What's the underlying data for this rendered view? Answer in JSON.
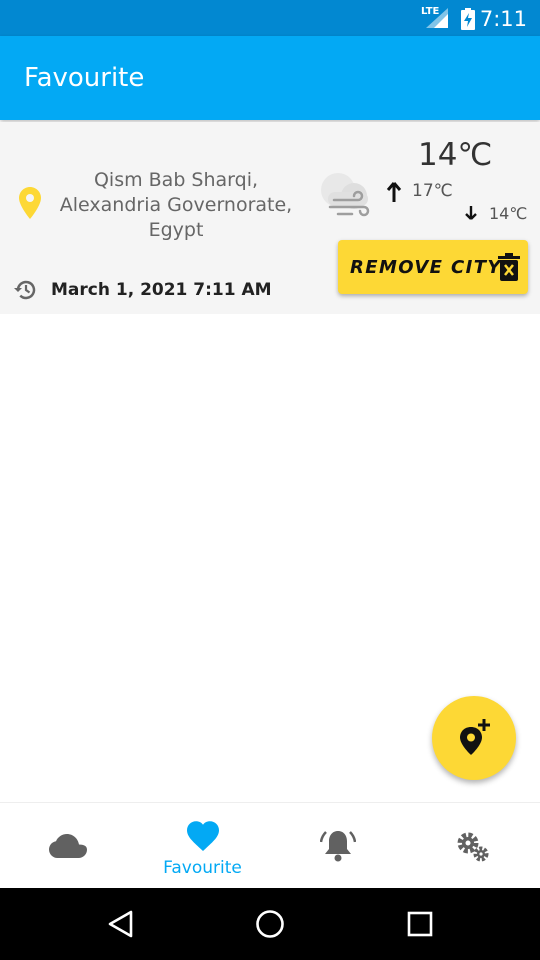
{
  "status_bar": {
    "time": "7:11",
    "network": "LTE"
  },
  "app_bar": {
    "title": "Favourite"
  },
  "city_card": {
    "address": "Qism Bab Sharqi, Alexandria Governorate, Egypt",
    "temperature": "14℃",
    "temp_max": "17℃",
    "temp_min": "14℃",
    "date_time": "March 1, 2021 7:11 AM",
    "remove_button": "REMOVE CITY"
  },
  "bottom_nav": {
    "items": [
      {
        "icon": "cloud-icon",
        "label": ""
      },
      {
        "icon": "heart-icon",
        "label": "Favourite",
        "selected": true
      },
      {
        "icon": "alarm-bell-icon",
        "label": ""
      },
      {
        "icon": "settings-gears-icon",
        "label": ""
      }
    ]
  },
  "colors": {
    "primary_dark": "#0288d1",
    "primary": "#03a9f4",
    "accent": "#fdd835",
    "pin": "#fdd835"
  }
}
